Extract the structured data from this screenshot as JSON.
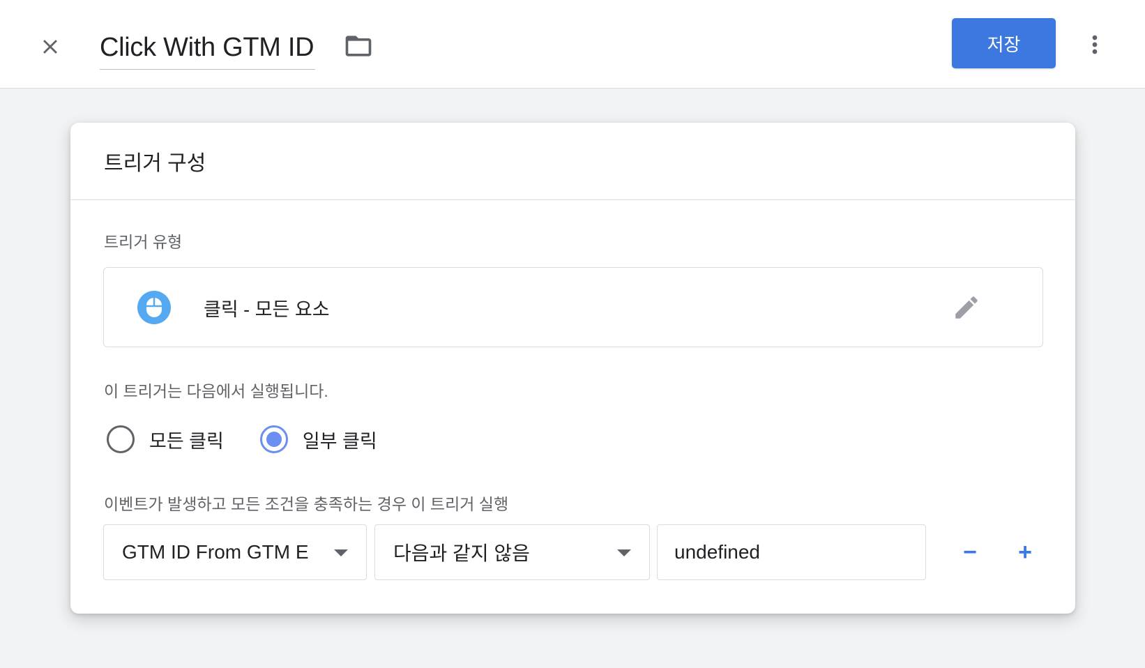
{
  "header": {
    "title": "Click With GTM ID",
    "save_label": "저장"
  },
  "card": {
    "title": "트리거 구성",
    "trigger_type_label": "트리거 유형",
    "trigger_type_name": "클릭 - 모든 요소",
    "fires_on_label": "이 트리거는 다음에서 실행됩니다.",
    "radio_options": [
      {
        "label": "모든 클릭",
        "checked": false
      },
      {
        "label": "일부 클릭",
        "checked": true
      }
    ],
    "condition_label": "이벤트가 발생하고 모든 조건을 충족하는 경우 이 트리거 실행",
    "condition": {
      "variable": "GTM ID From GTM E",
      "operator": "다음과 같지 않음",
      "value": "undefined"
    },
    "remove_label": "−",
    "add_label": "+"
  },
  "colors": {
    "accent": "#3c78e0",
    "radio_checked": "#6b8ef0",
    "mouse_icon_bg": "#54a9f0",
    "background": "#f1f3f4"
  },
  "icons": {
    "close": "close-icon",
    "folder": "folder-icon",
    "more": "more-vert-icon",
    "trigger_type": "mouse-icon",
    "edit": "pencil-icon"
  }
}
